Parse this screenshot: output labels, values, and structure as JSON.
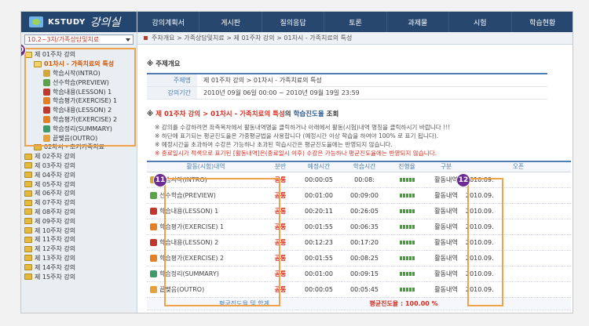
{
  "app": {
    "logo": "KSTUDY",
    "logo_sub": "강의실"
  },
  "nav": [
    "강의계획서",
    "게시판",
    "질의응답",
    "토론",
    "과제물",
    "시험",
    "학습현황"
  ],
  "course_select": "10.2~3차/가족상담및치료",
  "breadcrumb": "주차개요 > 가족상담및치료 > 제 01주차 강의 > 01차시 - 가족치료의 특성",
  "tree": {
    "week1": "제 01주차 강의",
    "lesson1": "01차시 - 가족치료의 특성",
    "items": [
      "학습시작(INTRO)",
      "선수학습(PREVIEW)",
      "학습내용(LESSON) 1",
      "학습평가(EXERCISE) 1",
      "학습내용(LESSON) 2",
      "학습평가(EXERCISE) 2",
      "학습정리(SUMMARY)",
      "끝맺음(OUTRO)"
    ],
    "lesson2": "02차시 - 초기가족치료",
    "weeks": [
      "제 02주차 강의",
      "제 03주차 강의",
      "제 04주차 강의",
      "제 05주차 강의",
      "제 06주차 강의",
      "제 07주차 강의",
      "제 08주차 강의",
      "제 09주차 강의",
      "제 10주차 강의",
      "제 11주차 강의",
      "제 12주차 강의",
      "제 13주차 강의",
      "제 14주차 강의",
      "제 15주차 강의"
    ]
  },
  "badges": {
    "b10": "10",
    "b11": "11",
    "b12": "12"
  },
  "overview": {
    "title": "※ 주제개요",
    "subject_label": "주제명",
    "subject": "제 01주차 강의 > 01차시 - 가족치료의 특성",
    "period_label": "강의기간",
    "period": "2010년 09월 06일 00:00 ~ 2010년 09월 19일 23:59"
  },
  "progress": {
    "prefix": "※",
    "week": "제 01주차 강의",
    "sep": ">",
    "lesson": "01차시 - 가족치료의 특성",
    "mid": "의",
    "label": "학습진도율",
    "suffix": "조회"
  },
  "notes": [
    "※ 강의를 수강하려면 좌측목차에서 활동내역명을 클릭하거나 아래에서 활동(시험)내역 명칭을 클릭하시기 바랍니다 !!!",
    "※ 하단에 표기되는 평균진도율은 가중평균법을 사용합니다 (예정시간 이상 학습을 하여야 100% 로 표기 됩니다).",
    "※ 예정시간을 초과하여 수강은 가능하나 초과된 학습시간은 평균진도율에는 반영되지 않습니다.",
    "※ 종료일시가 적색으로 표기된 [활동내역]은(종료일시 이후) 수강은 가능하나 평균진도율에는 반영되지 않습니다."
  ],
  "table": {
    "headers": [
      "활동(시험)내역",
      "분반",
      "예정시간",
      "학습시간",
      "진행율",
      "구분",
      "오픈"
    ],
    "rows": [
      {
        "name": "학습시작(INTRO)",
        "group": "공통",
        "planned": "00:00:05",
        "studied": "00:08:",
        "kind": "활동내역",
        "open": "2010.09."
      },
      {
        "name": "선수학습(PREVIEW)",
        "group": "공통",
        "planned": "00:01:00",
        "studied": "00:09:00",
        "kind": "활동내역",
        "open": "2010.09."
      },
      {
        "name": "학습내용(LESSON) 1",
        "group": "공통",
        "planned": "00:20:11",
        "studied": "00:26:05",
        "kind": "활동내역",
        "open": "2010.09."
      },
      {
        "name": "학습평가(EXERCISE) 1",
        "group": "공통",
        "planned": "00:01:55",
        "studied": "00:06:35",
        "kind": "활동내역",
        "open": "2010.09."
      },
      {
        "name": "학습내용(LESSON) 2",
        "group": "공통",
        "planned": "00:12:23",
        "studied": "00:17:20",
        "kind": "활동내역",
        "open": "2010.09."
      },
      {
        "name": "학습평가(EXERCISE) 2",
        "group": "공통",
        "planned": "00:01:55",
        "studied": "00:08:25",
        "kind": "활동내역",
        "open": "2010.09."
      },
      {
        "name": "학습정리(SUMMARY)",
        "group": "공통",
        "planned": "00:01:00",
        "studied": "00:09:15",
        "kind": "활동내역",
        "open": "2010.09."
      },
      {
        "name": "끝맺음(OUTRO)",
        "group": "공통",
        "planned": "00:00:05",
        "studied": "00:05:45",
        "kind": "활동내역",
        "open": "2010.09."
      }
    ],
    "footer_label": "평균진도율 및 합계",
    "avg_label": "평균진도율",
    "avg_value": "100.00 %"
  },
  "colors": {
    "nav_bg": "#27476f",
    "highlight": "#f0a14a",
    "badge": "#6c2c91",
    "progress": "#3aa52a"
  }
}
